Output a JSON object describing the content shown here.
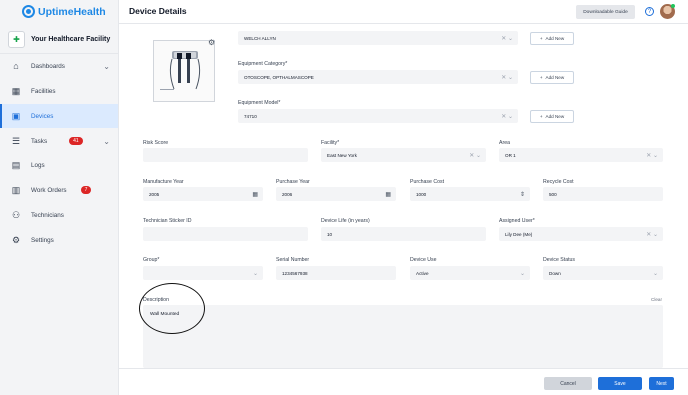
{
  "app": {
    "brand": "UptimeHealth"
  },
  "facility": {
    "name": "Your Healthcare Facility"
  },
  "sidebar": {
    "items": [
      {
        "label": "Dashboards"
      },
      {
        "label": "Facilities"
      },
      {
        "label": "Devices"
      },
      {
        "label": "Tasks",
        "badge": "41"
      },
      {
        "label": "Logs"
      },
      {
        "label": "Work Orders",
        "badge": "7"
      },
      {
        "label": "Technicians"
      },
      {
        "label": "Settings"
      }
    ]
  },
  "header": {
    "title": "Device Details",
    "guide_label": "Downloadable Guide",
    "help": "?"
  },
  "form": {
    "manufacturer_value": "WELCH ALLYN",
    "category": {
      "label": "Equipment Category*",
      "value": "OTOSCOPE, OPTHALMASCOPE"
    },
    "model": {
      "label": "Equipment Model*",
      "value": "74710"
    },
    "add_new_label": "Add New",
    "risk_score": {
      "label": "Risk Score",
      "value": ""
    },
    "facility": {
      "label": "Facility*",
      "value": "East New York"
    },
    "area": {
      "label": "Area",
      "value": "OR 1"
    },
    "manufacture_year": {
      "label": "Manufacture Year",
      "value": "2005"
    },
    "purchase_year": {
      "label": "Purchase Year",
      "value": "2006"
    },
    "purchase_cost": {
      "label": "Purchase Cost",
      "value": "1000"
    },
    "recycle_cost": {
      "label": "Recycle Cost",
      "value": "500"
    },
    "sticker_id": {
      "label": "Technician Sticker ID",
      "value": ""
    },
    "device_life": {
      "label": "Device Life (in years)",
      "value": "10"
    },
    "assigned_user": {
      "label": "Assigned User*",
      "value": "Lily Dee (Me)"
    },
    "group": {
      "label": "Group*",
      "value": ""
    },
    "serial_number": {
      "label": "Serial Number",
      "value": "1234567938"
    },
    "device_use": {
      "label": "Device Use",
      "value": "Active"
    },
    "device_status": {
      "label": "Device Status",
      "value": "Down"
    },
    "description": {
      "label": "Description",
      "value": "Wall Mounted",
      "clear_label": "Clear"
    }
  },
  "footer": {
    "cancel_label": "Cancel",
    "save_label": "Save",
    "next_label": "Next"
  },
  "colors": {
    "accent": "#1e6fd9",
    "badge": "#dc2626",
    "sidebar_bg": "#f3f4f6",
    "field_bg": "#f3f4f6"
  }
}
